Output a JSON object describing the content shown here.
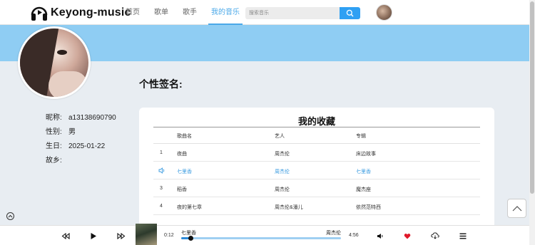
{
  "header": {
    "brand": "Keyong-music",
    "nav": [
      "首页",
      "歌单",
      "歌手",
      "我的音乐"
    ],
    "active_nav": "我的音乐",
    "search_placeholder": "搜索音乐"
  },
  "profile": {
    "signature_label": "个性签名:",
    "signature_value": "",
    "fields": [
      {
        "label": "昵称:",
        "value": "a13138690790"
      },
      {
        "label": "性别:",
        "value": "男"
      },
      {
        "label": "生日:",
        "value": "2025-01-22"
      },
      {
        "label": "故乡:",
        "value": ""
      }
    ]
  },
  "favorites": {
    "title": "我的收藏",
    "columns": [
      "歌曲名",
      "艺人",
      "专辑"
    ],
    "rows": [
      {
        "index": "1",
        "song": "夜曲",
        "artist": "周杰伦",
        "album": "床边故事",
        "playing": false
      },
      {
        "index": "",
        "song": "七里香",
        "artist": "周杰伦",
        "album": "七里香",
        "playing": true
      },
      {
        "index": "3",
        "song": "稻香",
        "artist": "周杰伦",
        "album": "魔杰座",
        "playing": false
      },
      {
        "index": "4",
        "song": "夜的第七章",
        "artist": "周杰伦&潘儿",
        "album": "依然范特西",
        "playing": false
      }
    ]
  },
  "player": {
    "current_time": "0:12",
    "total_time": "4:56",
    "song": "七里香",
    "artist": "周杰伦",
    "progress": 0.06,
    "liked": true,
    "colors": {
      "accent": "#2fa0f3",
      "like": "#e0192a"
    }
  }
}
